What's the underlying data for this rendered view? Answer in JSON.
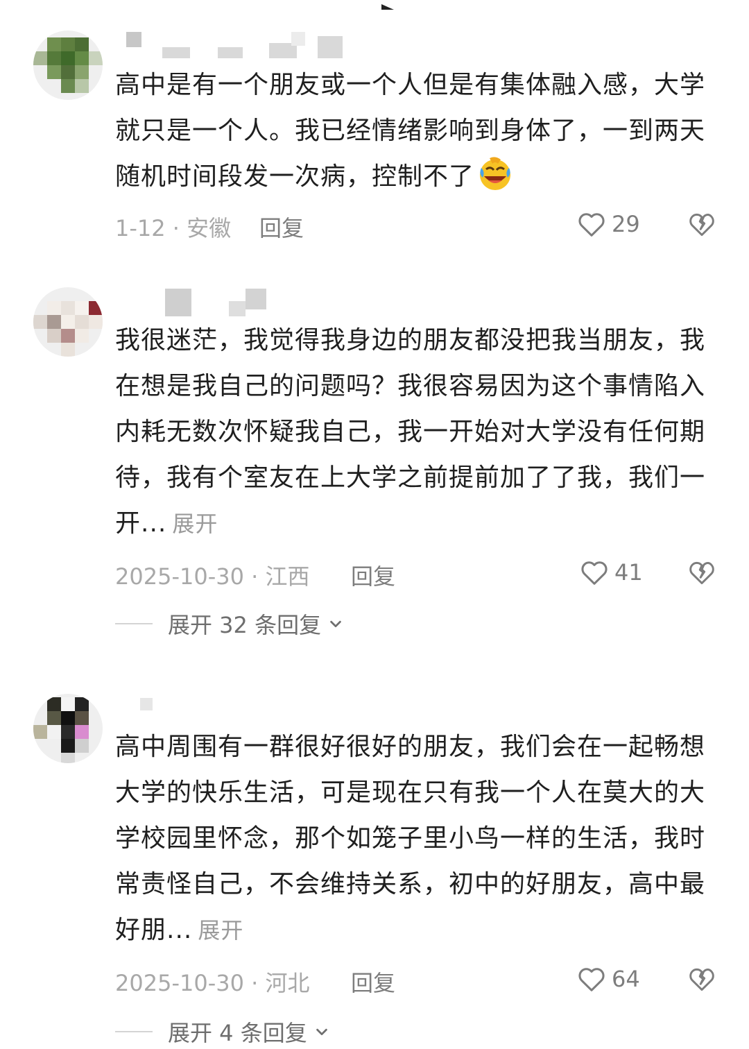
{
  "comments": [
    {
      "text": "高中是有一个朋友或一个人但是有集体融入感，大学就只是一个人。我已经情绪影响到身体了，一到两天随机时间段发一次病，控制不了",
      "emoji": "laughing-crying-emoji",
      "time_location": "1-12 · 安徽",
      "reply_label": "回复",
      "likes": "29"
    },
    {
      "text": "我很迷茫，我觉得我身边的朋友都没把我当朋友，我在想是我自己的问题吗？我很容易因为这个事情陷入内耗无数次怀疑我自己，我一开始对大学没有任何期待，我有个室友在上大学之前提前加了了我，我们一开...",
      "expand_label": "展开",
      "time_location": "2025-10-30 · 江西",
      "reply_label": "回复",
      "likes": "41",
      "expand_replies_label": "展开 32 条回复"
    },
    {
      "text": "高中周围有一群很好很好的朋友，我们会在一起畅想大学的快乐生活，可是现在只有我一个人在莫大的大学校园里怀念，那个如笼子里小鸟一样的生活，我时常责怪自己，不会维持关系，初中的好朋友，高中最好朋...",
      "expand_label": "展开",
      "time_location": "2025-10-30 · 河北",
      "reply_label": "回复",
      "likes": "64",
      "expand_replies_label": "展开 4 条回复"
    }
  ],
  "colors": {
    "text": "#1f1f1f",
    "meta": "#a8a8a8",
    "action": "#7d7d7d"
  },
  "icons": [
    "heart-outline-icon",
    "broken-heart-icon",
    "chevron-down-icon"
  ]
}
